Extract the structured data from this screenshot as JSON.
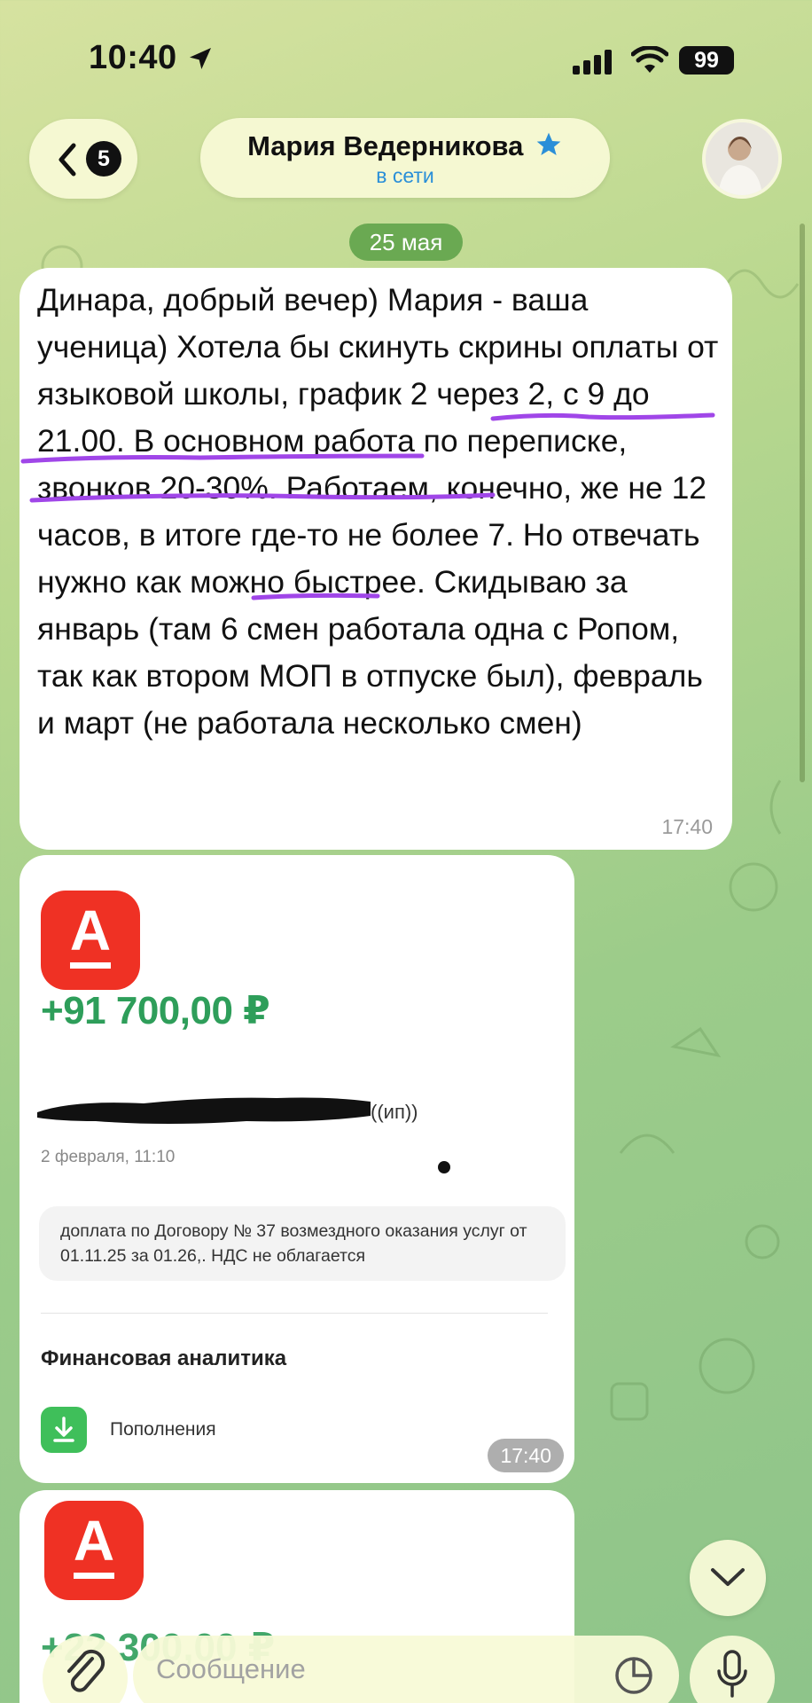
{
  "status_bar": {
    "time": "10:40",
    "battery": "99"
  },
  "header": {
    "unread_count": "5",
    "contact_name": "Мария Ведерникова",
    "contact_status": "в сети"
  },
  "chat": {
    "date_label": "25 мая",
    "messages": [
      {
        "text": "Динара, добрый вечер) Мария - ваша ученица) Хотела бы скинуть скрины оплаты от языковой школы, график 2 через 2, с 9 до 21.00. В основном работа по переписке, звонков 20-30%. Работаем, конечно, же не 12 часов, в итоге где-то не более 7. Но отвечать нужно как можно быстрее. Скидываю за январь (там 6 смен работала одна с Ропом, так как втором МОП в отпуске был), февраль и март (не работала несколько смен)",
        "time": "17:40"
      }
    ],
    "image_message": {
      "bank_letter": "А",
      "amount": "+91 700,00 ₽",
      "recipient_suffix": "((ип))",
      "payment_date": "2 февраля, 11:10",
      "purpose": "доплата по Договору № 37 возмездного оказания услуг от 01.11.25 за 01.26,. НДС не облагается",
      "section_title": "Финансовая аналитика",
      "category": "Пополнения",
      "time": "17:40"
    },
    "image_message_2": {
      "bank_letter": "А",
      "amount_partial": "+22 300,00 ₽"
    }
  },
  "composer": {
    "placeholder": "Сообщение"
  },
  "colors": {
    "accent_blue": "#2a8fd8",
    "bank_red": "#ef3124",
    "amount_green": "#2e9e5a",
    "highlight_purple": "#a046e8"
  }
}
